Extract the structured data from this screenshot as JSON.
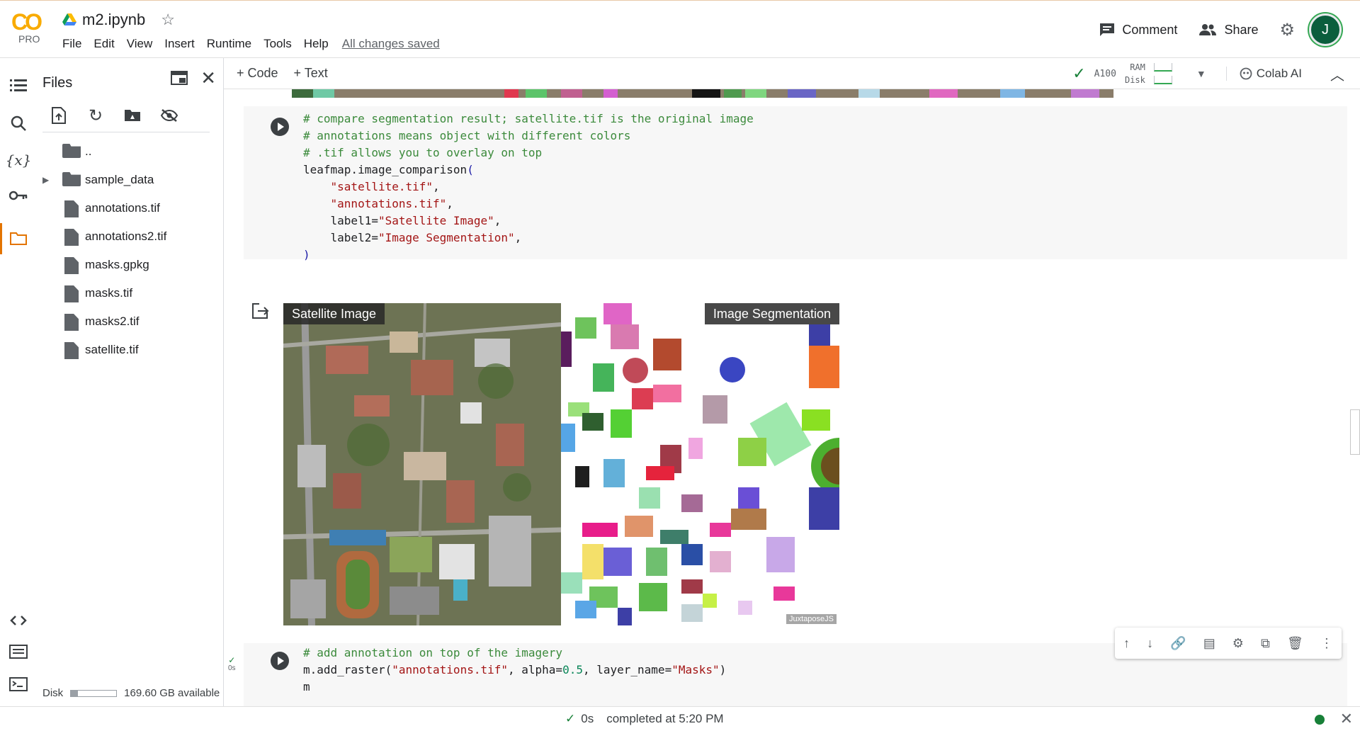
{
  "app": {
    "logo_text": "CO",
    "plan_badge": "PRO",
    "notebook_title": "m2.ipynb",
    "menu": [
      "File",
      "Edit",
      "View",
      "Insert",
      "Runtime",
      "Tools",
      "Help"
    ],
    "save_status": "All changes saved",
    "comment_label": "Comment",
    "share_label": "Share",
    "avatar_initial": "J",
    "accent_color": "#f9ab00"
  },
  "toolbar": {
    "add_code": "+ Code",
    "add_text": "+ Text",
    "runtime_gpu": "A100",
    "ram_label": "RAM",
    "disk_label": "Disk",
    "colab_ai": "Colab AI"
  },
  "files": {
    "title": "Files",
    "parent_dir": "..",
    "items": [
      {
        "name": "sample_data",
        "type": "folder"
      },
      {
        "name": "annotations.tif",
        "type": "file"
      },
      {
        "name": "annotations2.tif",
        "type": "file"
      },
      {
        "name": "masks.gpkg",
        "type": "file"
      },
      {
        "name": "masks.tif",
        "type": "file"
      },
      {
        "name": "masks2.tif",
        "type": "file"
      },
      {
        "name": "satellite.tif",
        "type": "file"
      }
    ],
    "disk_label": "Disk",
    "disk_available": "169.60 GB available",
    "disk_used_fraction": 0.15
  },
  "cells": {
    "cell1": {
      "lines": [
        {
          "parts": [
            [
              "c-com",
              "# compare segmentation result; satellite.tif is the original image"
            ]
          ]
        },
        {
          "parts": [
            [
              "c-com",
              "# annotations means object with different colors"
            ]
          ]
        },
        {
          "parts": [
            [
              "c-com",
              "# .tif allows you to overlay on top"
            ]
          ]
        },
        {
          "parts": [
            [
              "",
              "leafmap.image_comparison"
            ],
            [
              "c-paren",
              "("
            ]
          ]
        },
        {
          "parts": [
            [
              "",
              "    "
            ],
            [
              "c-str",
              "\"satellite.tif\""
            ],
            [
              "",
              ","
            ]
          ]
        },
        {
          "parts": [
            [
              "",
              "    "
            ],
            [
              "c-str",
              "\"annotations.tif\""
            ],
            [
              "",
              ","
            ]
          ]
        },
        {
          "parts": [
            [
              "",
              "    label1="
            ],
            [
              "c-str",
              "\"Satellite Image\""
            ],
            [
              "",
              ","
            ]
          ]
        },
        {
          "parts": [
            [
              "",
              "    label2="
            ],
            [
              "c-str",
              "\"Image Segmentation\""
            ],
            [
              "",
              ","
            ]
          ]
        },
        {
          "parts": [
            [
              "c-paren",
              ")"
            ]
          ]
        }
      ],
      "output": {
        "left_label": "Satellite Image",
        "right_label": "Image Segmentation",
        "credit": "JuxtaposeJS"
      }
    },
    "cell2": {
      "exec_time": "0s",
      "lines": [
        {
          "parts": [
            [
              "c-com",
              "# add annotation on top of the imagery"
            ]
          ]
        },
        {
          "parts": [
            [
              "",
              "m.add_raster("
            ],
            [
              "c-str",
              "\"annotations.tif\""
            ],
            [
              "",
              ", alpha="
            ],
            [
              "c-num",
              "0.5"
            ],
            [
              "",
              ", layer_name="
            ],
            [
              "c-str",
              "\"Masks\""
            ],
            [
              "",
              ")"
            ]
          ]
        },
        {
          "parts": [
            [
              "",
              "m"
            ]
          ]
        }
      ]
    }
  },
  "status": {
    "duration": "0s",
    "message": "completed at 5:20 PM"
  }
}
